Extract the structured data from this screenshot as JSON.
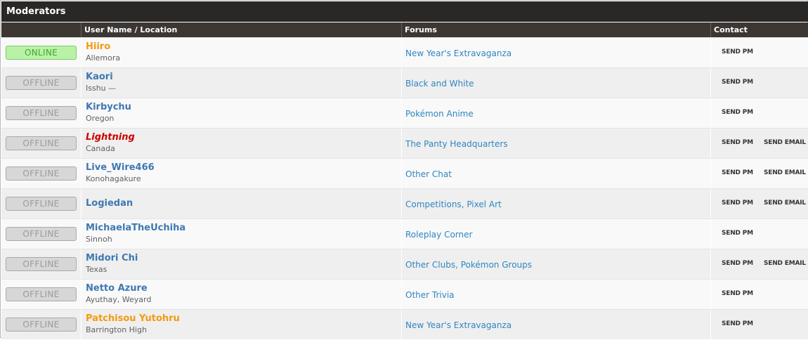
{
  "panel": {
    "title": "Moderators"
  },
  "columns": {
    "status": "",
    "user": "User Name / Location",
    "forums": "Forums",
    "contact": "Contact"
  },
  "contact_labels": {
    "pm": "SEND PM",
    "email": "SEND EMAIL"
  },
  "moderators": [
    {
      "status": "ONLINE",
      "status_type": "online",
      "name": "Hiiro",
      "name_color": "orange",
      "location": "Allemora",
      "forums": [
        "New Year's Extravaganza"
      ],
      "email": false
    },
    {
      "status": "OFFLINE",
      "status_type": "offline",
      "name": "Kaori",
      "name_color": "blue",
      "location": "Isshu —",
      "forums": [
        "Black and White"
      ],
      "email": false
    },
    {
      "status": "OFFLINE",
      "status_type": "offline",
      "name": "Kirbychu",
      "name_color": "blue",
      "location": "Oregon",
      "forums": [
        "Pokémon Anime"
      ],
      "email": false
    },
    {
      "status": "OFFLINE",
      "status_type": "offline",
      "name": "Lightning",
      "name_color": "red",
      "location": "Canada",
      "forums": [
        "The Panty Headquarters"
      ],
      "email": true
    },
    {
      "status": "OFFLINE",
      "status_type": "offline",
      "name": "Live_Wire466",
      "name_color": "blue",
      "location": "Konohagakure",
      "forums": [
        "Other Chat"
      ],
      "email": true
    },
    {
      "status": "OFFLINE",
      "status_type": "offline",
      "name": "Logiedan",
      "name_color": "blue",
      "location": "",
      "forums": [
        "Competitions",
        "Pixel Art"
      ],
      "email": true
    },
    {
      "status": "OFFLINE",
      "status_type": "offline",
      "name": "MichaelaTheUchiha",
      "name_color": "blue",
      "location": "Sinnoh",
      "forums": [
        "Roleplay Corner"
      ],
      "email": false
    },
    {
      "status": "OFFLINE",
      "status_type": "offline",
      "name": "Midori Chi",
      "name_color": "blue",
      "location": "Texas",
      "forums": [
        "Other Clubs",
        "Pokémon Groups"
      ],
      "email": true
    },
    {
      "status": "OFFLINE",
      "status_type": "offline",
      "name": "Netto Azure",
      "name_color": "blue",
      "location": "Ayuthay, Weyard",
      "forums": [
        "Other Trivia"
      ],
      "email": false
    },
    {
      "status": "OFFLINE",
      "status_type": "offline",
      "name": "Patchisou Yutohru",
      "name_color": "orange",
      "location": "Barrington High",
      "forums": [
        "New Year's Extravaganza"
      ],
      "email": false
    }
  ]
}
